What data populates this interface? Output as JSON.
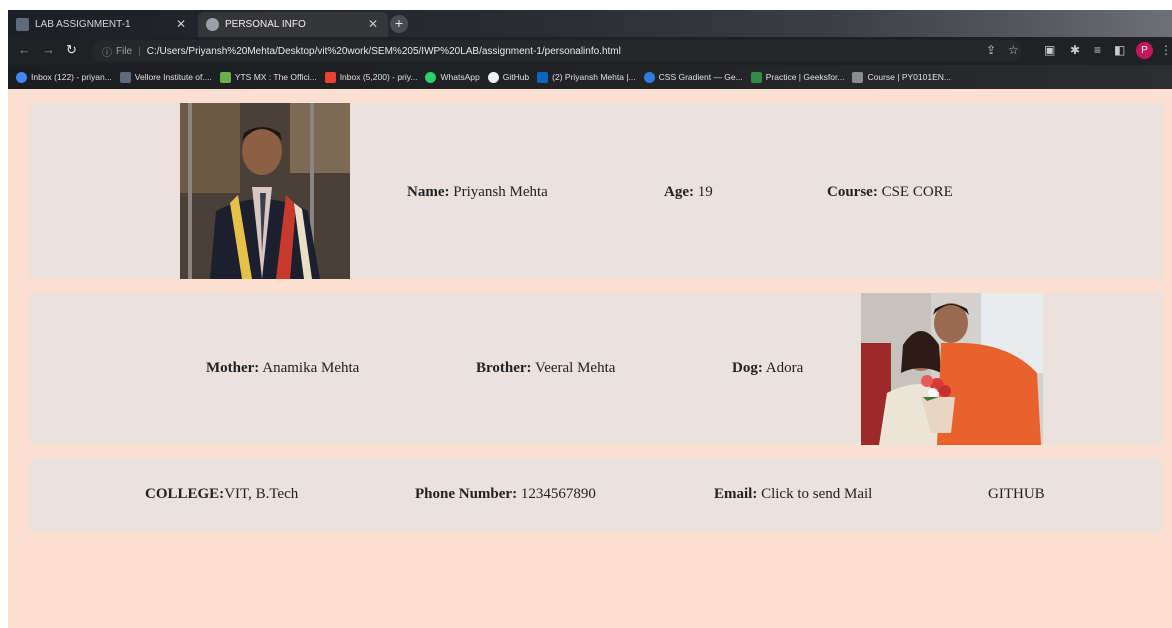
{
  "browser": {
    "tabs": [
      {
        "label": "LAB ASSIGNMENT-1",
        "active": false
      },
      {
        "label": "PERSONAL INFO",
        "active": true
      }
    ],
    "new_tab_label": "+",
    "url_scheme": "File",
    "url": "C:/Users/Priyansh%20Mehta/Desktop/vit%20work/SEM%205/IWP%20LAB/assignment-1/personalinfo.html",
    "profile_initial": "P",
    "bookmarks": [
      {
        "label": "Inbox (122) - priyan...",
        "color": "#4285f4"
      },
      {
        "label": "Vellore Institute of....",
        "color": "#5f6a7a"
      },
      {
        "label": "YTS MX : The Offici...",
        "color": "#6ab04c"
      },
      {
        "label": "Inbox (5,200) - priy...",
        "color": "#ea4335"
      },
      {
        "label": "WhatsApp",
        "color": "#25d366"
      },
      {
        "label": "GitHub",
        "color": "#f0f0f0"
      },
      {
        "label": "(2) Priyansh Mehta |...",
        "color": "#0a66c2"
      },
      {
        "label": "CSS Gradient — Ge...",
        "color": "#2f7de1"
      },
      {
        "label": "Practice | Geeksfor...",
        "color": "#2f8d46"
      },
      {
        "label": "Course | PY0101EN...",
        "color": "#8a8c90"
      }
    ]
  },
  "profile": {
    "name_label": "Name:",
    "name": "Priyansh Mehta",
    "age_label": "Age:",
    "age": "19",
    "course_label": "Course:",
    "course": "CSE CORE"
  },
  "family": {
    "mother_label": "Mother:",
    "mother": "Anamika Mehta",
    "brother_label": "Brother:",
    "brother": "Veeral Mehta",
    "dog_label": "Dog:",
    "dog": "Adora"
  },
  "contact": {
    "college_label": "COLLEGE:",
    "college": "VIT, B.Tech",
    "phone_label": "Phone Number:",
    "phone": "1234567890",
    "email_label": "Email:",
    "email_link": "Click to send Mail",
    "github_link": "GITHUB"
  },
  "colors": {
    "page_background": "#fbdfd1",
    "row_background": "#ebe1dd"
  }
}
